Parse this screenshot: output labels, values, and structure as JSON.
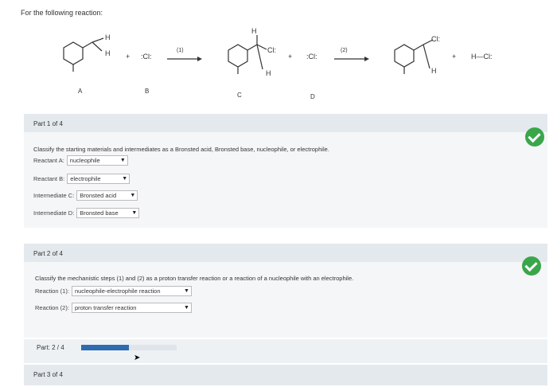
{
  "intro": "For the following reaction:",
  "scheme": {
    "plus": "+",
    "h": "H",
    "chloride": ":Cl:",
    "cl_top": "Cl:",
    "hcl": "H—Cl:",
    "arrow1_label": "(1)",
    "arrow2_label": "(2)",
    "labels": [
      "A",
      "B",
      "C",
      "D"
    ]
  },
  "part1": {
    "header": "Part 1 of 4",
    "question": "Classify the starting materials and intermediates as a Bronsted acid, Bronsted base, nucleophile, or electrophile.",
    "rows": [
      {
        "label": "Reactant A:",
        "value": "nucleophile"
      },
      {
        "label": "Reactant B:",
        "value": "electrophile"
      },
      {
        "label": "Intermediate C:",
        "value": "Bronsted acid"
      },
      {
        "label": "Intermediate D:",
        "value": "Bronsted base"
      }
    ]
  },
  "part2": {
    "header": "Part 2 of 4",
    "question": "Classify the mechanistic steps (1) and (2) as a proton transfer reaction or a reaction of a nucleophile with an electrophile.",
    "rows": [
      {
        "label": "Reaction (1):",
        "value": "nucleophile-electrophile reaction"
      },
      {
        "label": "Reaction (2):",
        "value": "proton transfer reaction"
      }
    ]
  },
  "progress": {
    "label": "Part: 2 / 4",
    "fraction": 0.5
  },
  "part3": {
    "header": "Part 3 of 4"
  },
  "colors": {
    "check": "#3aa64a",
    "progress": "#2d6cb0",
    "header_bg": "#e4e9ee"
  }
}
